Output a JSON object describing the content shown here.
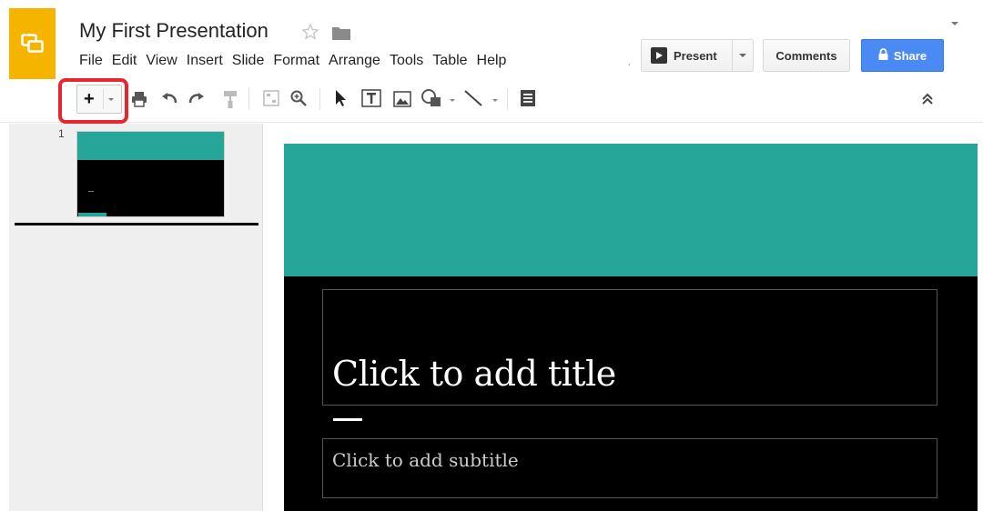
{
  "app": {
    "document_title": "My First Presentation",
    "menu": [
      "File",
      "Edit",
      "View",
      "Insert",
      "Slide",
      "Format",
      "Arrange",
      "Tools",
      "Table",
      "Help"
    ],
    "menu_overflow": "¸"
  },
  "header_buttons": {
    "present_label": "Present",
    "comments_label": "Comments",
    "share_label": "Share"
  },
  "toolbar": {
    "new_slide_label": "+",
    "icons": [
      "plus-icon",
      "print-icon",
      "undo-icon",
      "redo-icon",
      "paint-format-icon",
      "zoom-fit-icon",
      "zoom-icon",
      "select-icon",
      "text-box-icon",
      "image-icon",
      "shape-icon",
      "line-icon",
      "speaker-notes-icon",
      "collapse-icon"
    ]
  },
  "filmstrip": {
    "slides": [
      {
        "number": "1"
      }
    ]
  },
  "slide": {
    "title_placeholder": "Click to add title",
    "subtitle_placeholder": "Click to add subtitle"
  },
  "colors": {
    "accent_teal": "#26a599",
    "logo_yellow": "#f4b400",
    "share_blue": "#4a8af4",
    "highlight_red": "#e8262f"
  }
}
